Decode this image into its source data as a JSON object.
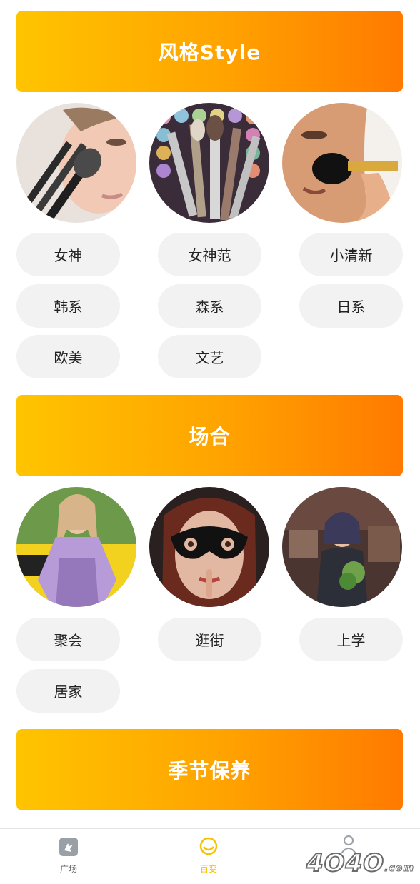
{
  "sections": [
    {
      "title": "风格Style",
      "tags": [
        "女神",
        "女神范",
        "小清新",
        "韩系",
        "森系",
        "日系",
        "欧美",
        "文艺"
      ]
    },
    {
      "title": "场合",
      "tags": [
        "聚会",
        "逛街",
        "上学",
        "居家"
      ]
    },
    {
      "title": "季节保养"
    }
  ],
  "bottom_nav": [
    {
      "label": "广场",
      "icon": "square-icon",
      "active": false
    },
    {
      "label": "百变",
      "icon": "face-icon",
      "active": true,
      "color": "#f5c200"
    },
    {
      "label": "",
      "icon": "profile-icon",
      "active": false
    }
  ],
  "watermark": {
    "text": "4O4O",
    "suffix": ".com"
  },
  "colors": {
    "banner_start": "#ffc400",
    "banner_end": "#ff7a00",
    "tag_bg": "#f2f2f2",
    "active_nav": "#f5c200"
  }
}
